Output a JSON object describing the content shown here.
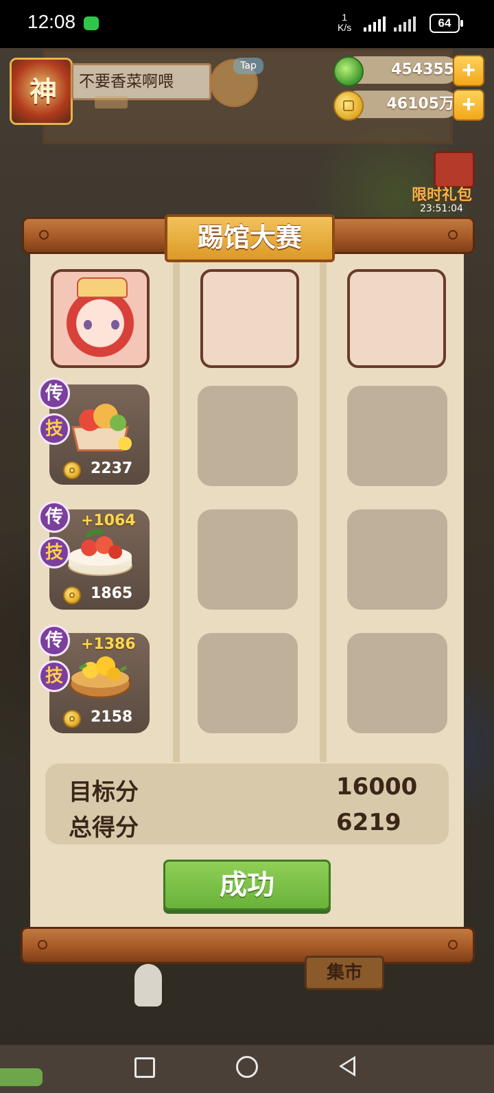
{
  "status_bar": {
    "time": "12:08",
    "net_speed_value": "1",
    "net_speed_unit": "K/s",
    "battery": "64"
  },
  "hud": {
    "avatar_char": "神",
    "player_name": "不要香菜啊喂",
    "tap_label": "Tap",
    "jade_count": "454355",
    "coin_count": "46105万",
    "plus": "+",
    "gift_label": "限时礼包",
    "gift_timer": "23:51:04"
  },
  "panel": {
    "title": "踢馆大赛",
    "dishes": [
      {
        "legend_badge": "传",
        "skill_badge": "技",
        "bonus": "",
        "price": "2237"
      },
      {
        "legend_badge": "传",
        "skill_badge": "技",
        "bonus": "+1064",
        "price": "1865"
      },
      {
        "legend_badge": "传",
        "skill_badge": "技",
        "bonus": "+1386",
        "price": "2158"
      }
    ],
    "score": {
      "target_label": "目标分",
      "target_value": "16000",
      "total_label": "总得分",
      "total_value": "6219"
    },
    "result_button": "成功"
  },
  "background": {
    "market_sign": "集市"
  },
  "colors": {
    "panel_bg": "#eadcc0",
    "title_gold": "#dc9a28",
    "success_green": "#6ab23a",
    "badge_purple": "#7b3f9c"
  }
}
